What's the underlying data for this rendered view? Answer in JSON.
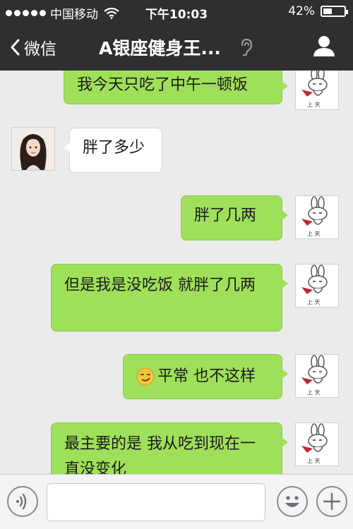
{
  "status_bar": {
    "carrier": "中国移动",
    "time": "下午10:03",
    "battery_percent": "42%",
    "battery_level": 0.42
  },
  "nav": {
    "back_label": "微信",
    "title": "A银座健身王..."
  },
  "messages": [
    {
      "side": "out",
      "text": "我今天只吃了中午一顿饭"
    },
    {
      "side": "in",
      "text": "胖了多少"
    },
    {
      "side": "out",
      "text": "胖了几两"
    },
    {
      "side": "out",
      "text": "但是我是没吃饭 就胖了几两"
    },
    {
      "side": "out",
      "emoji": "smirk-emoji",
      "text": "平常 也不这样"
    },
    {
      "side": "out",
      "text": "最主要的是 我从吃到现在一直没变化"
    }
  ],
  "avatar_caption": "上 天",
  "input": {
    "placeholder": ""
  }
}
